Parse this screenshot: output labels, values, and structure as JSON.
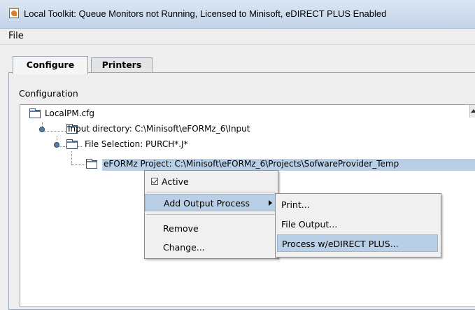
{
  "window": {
    "title": "Local Toolkit: Queue Monitors not Running, Licensed to Minisoft, eDIRECT PLUS Enabled",
    "icon": "java-app-icon"
  },
  "menubar": {
    "file": "File"
  },
  "tabs": [
    {
      "label": "Configure",
      "active": true
    },
    {
      "label": "Printers",
      "active": false
    }
  ],
  "configuration": {
    "group_label": "Configuration",
    "tree": {
      "root": "LocalPM.cfg",
      "input_dir": "Input directory: C:\\Minisoft\\eFORMz_6\\Input",
      "file_selection": "File Selection: PURCH*.J*",
      "project": "eFORMz Project: C:\\Minisoft\\eFORMz_6\\Projects\\SofwareProvider_Temp"
    }
  },
  "context_menu": {
    "active": "Active",
    "active_checked": true,
    "add_output_process": "Add Output Process",
    "remove": "Remove",
    "change": "Change..."
  },
  "submenu": {
    "print": "Print...",
    "file_output": "File Output...",
    "process_edirect": "Process w/eDIRECT PLUS..."
  },
  "colors": {
    "selection": "#b8cfe5",
    "titlebar": "#c3d4e9"
  }
}
